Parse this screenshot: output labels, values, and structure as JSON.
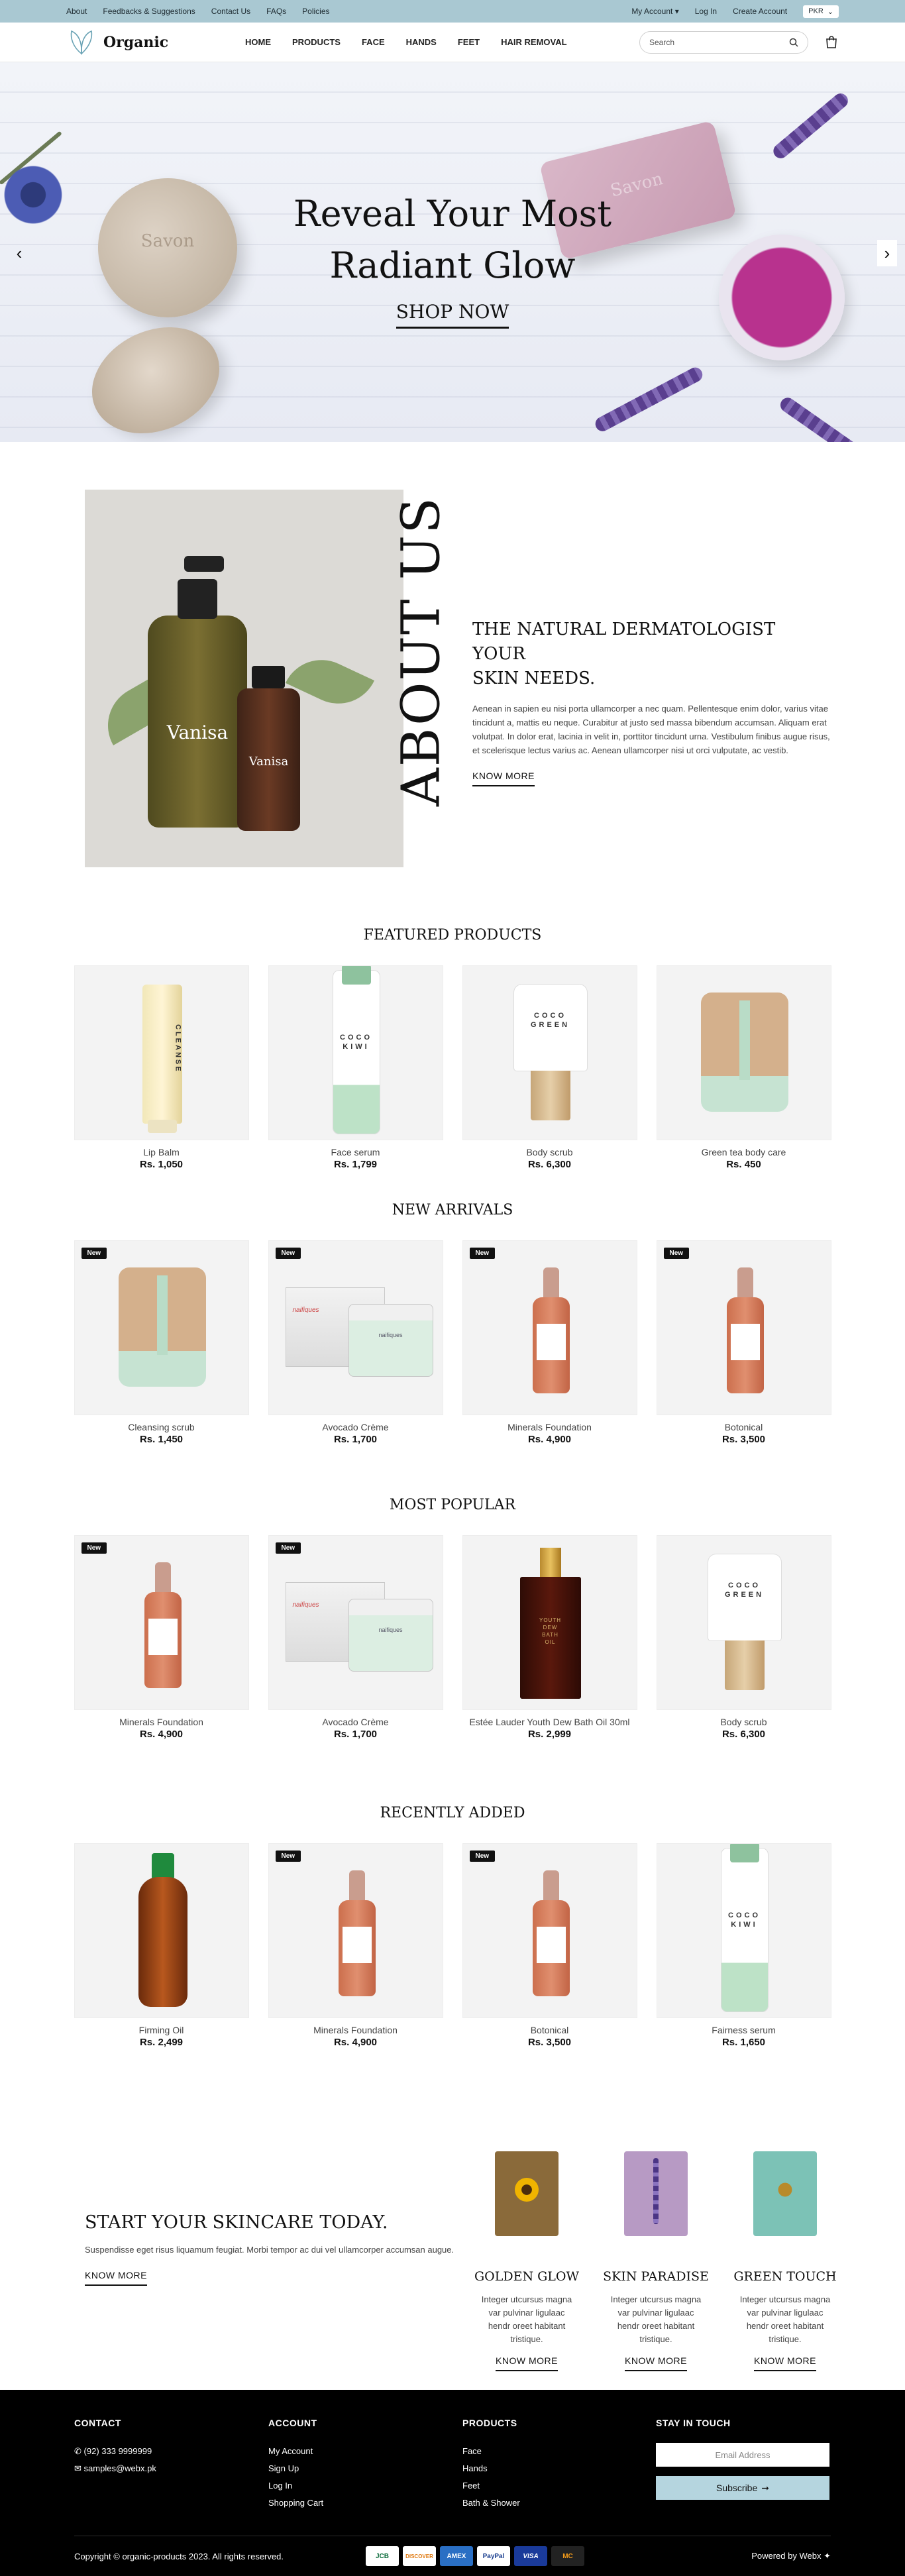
{
  "topbar": {
    "links": [
      "About",
      "Feedbacks & Suggestions",
      "Contact Us",
      "FAQs",
      "Policies"
    ],
    "my_account": "My Account",
    "login": "Log In",
    "create_account": "Create Account",
    "currency": "PKR"
  },
  "header": {
    "logo_text": "Organic",
    "nav": [
      "HOME",
      "PRODUCTS",
      "FACE",
      "HANDS",
      "FEET",
      "HAIR REMOVAL"
    ],
    "search_placeholder": "Search"
  },
  "hero": {
    "title_line1": "Reveal Your Most",
    "title_line2": "Radiant Glow",
    "cta": "SHOP NOW",
    "soap_text": "Savon"
  },
  "about": {
    "vertical_title": "ABOUT US",
    "heading_line1": "THE NATURAL DERMATOLOGIST YOUR",
    "heading_line2": "SKIN NEEDS.",
    "body": "Aenean in sapien eu nisi porta ullamcorper a nec quam. Pellentesque enim dolor, varius vitae tincidunt a, mattis eu neque. Curabitur at justo sed massa bibendum accumsan. Aliquam erat volutpat. In dolor erat, lacinia in velit in, porttitor tincidunt urna. Vestibulum finibus augue risus, et scelerisque lectus varius ac. Aenean ullamcorper nisi ut orci vulputate, ac vestib.",
    "cta": "KNOW MORE",
    "bottle_brand": "Vanisa"
  },
  "badge_label": "New",
  "sections": [
    {
      "title": "FEATURED PRODUCTS",
      "products": [
        {
          "name": "Lip Balm",
          "price": "Rs. 1,050",
          "img": "tube",
          "new": false
        },
        {
          "name": "Face serum",
          "price": "Rs. 1,799",
          "img": "serum",
          "new": false
        },
        {
          "name": "Body scrub",
          "price": "Rs. 6,300",
          "img": "scrub",
          "new": false
        },
        {
          "name": "Green tea body care",
          "price": "Rs. 450",
          "img": "jar",
          "new": false
        }
      ]
    },
    {
      "title": "NEW ARRIVALS",
      "products": [
        {
          "name": "Cleansing scrub",
          "price": "Rs. 1,450",
          "img": "jar",
          "new": true
        },
        {
          "name": "Avocado Crème",
          "price": "Rs. 1,700",
          "img": "cream",
          "new": true
        },
        {
          "name": "Minerals Foundation",
          "price": "Rs. 4,900",
          "img": "amber",
          "new": true
        },
        {
          "name": "Botonical",
          "price": "Rs. 3,500",
          "img": "amber",
          "new": true
        }
      ]
    },
    {
      "title": "MOST POPULAR",
      "products": [
        {
          "name": "Minerals Foundation",
          "price": "Rs. 4,900",
          "img": "amber",
          "new": true
        },
        {
          "name": "Avocado Crème",
          "price": "Rs. 1,700",
          "img": "cream",
          "new": true
        },
        {
          "name": "Estée Lauder Youth Dew Bath Oil 30ml",
          "price": "Rs. 2,999",
          "img": "perfume",
          "new": false
        },
        {
          "name": "Body scrub",
          "price": "Rs. 6,300",
          "img": "scrub",
          "new": false
        }
      ]
    },
    {
      "title": "RECENTLY ADDED",
      "products": [
        {
          "name": "Firming Oil",
          "price": "Rs. 2,499",
          "img": "firm",
          "new": false
        },
        {
          "name": "Minerals Foundation",
          "price": "Rs. 4,900",
          "img": "amber",
          "new": true
        },
        {
          "name": "Botonical",
          "price": "Rs. 3,500",
          "img": "amber",
          "new": true
        },
        {
          "name": "Fairness serum",
          "price": "Rs. 1,650",
          "img": "serum",
          "new": false
        }
      ]
    }
  ],
  "product_labels": {
    "tube": "CLEANSE",
    "coco_green": "COCO GREEN",
    "coco_kiwi": "COCO KIWI",
    "box": "naifiques",
    "perfume": "YOUTH DEW BATH OIL"
  },
  "skincare": {
    "heading": "START YOUR SKINCARE TODAY.",
    "body": "Suspendisse eget risus liquamum feugiat. Morbi tempor ac dui vel ullamcorper accumsan augue.",
    "cta": "KNOW MORE",
    "features": [
      {
        "title": "GOLDEN GLOW",
        "body": "Integer utcursus magna var pulvinar ligulaac hendr oreet habitant tristique.",
        "cta": "KNOW MORE",
        "color": "#8a6a3a"
      },
      {
        "title": "SKIN PARADISE",
        "body": "Integer utcursus magna var pulvinar ligulaac hendr oreet habitant tristique.",
        "cta": "KNOW MORE",
        "color": "#b79ac4"
      },
      {
        "title": "GREEN TOUCH",
        "body": "Integer utcursus magna var pulvinar ligulaac hendr oreet habitant tristique.",
        "cta": "KNOW MORE",
        "color": "#7cc2b6"
      }
    ]
  },
  "footer": {
    "contact_title": "CONTACT",
    "phone": "(92) 333 9999999",
    "email": "samples@webx.pk",
    "account_title": "ACCOUNT",
    "account_links": [
      "My Account",
      "Sign Up",
      "Log In",
      "Shopping Cart"
    ],
    "products_title": "PRODUCTS",
    "product_links": [
      "Face",
      "Hands",
      "Feet",
      "Bath & Shower"
    ],
    "stay_title": "STAY IN TOUCH",
    "email_placeholder": "Email Address",
    "subscribe": "Subscribe",
    "copyright": "Copyright © organic-products 2023. All rights reserved.",
    "powered": "Powered by Webx",
    "payment_cards": [
      "JCB",
      "DISCOVER",
      "AMEX",
      "PayPal",
      "VISA",
      "MC"
    ]
  }
}
